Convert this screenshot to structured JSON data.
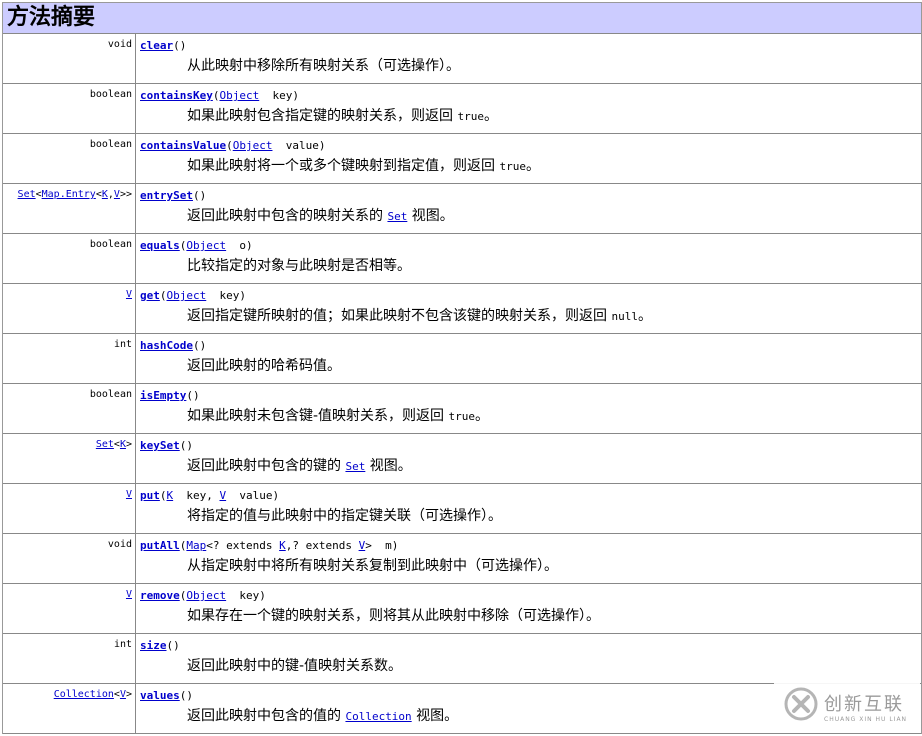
{
  "title": "方法摘要",
  "rows": [
    {
      "rtype": [
        {
          "text": "void"
        }
      ],
      "name": "clear",
      "params": [
        {
          "text": "()"
        }
      ],
      "desc": [
        {
          "text": "从此映射中移除所有映射关系（可选操作）。"
        }
      ]
    },
    {
      "rtype": [
        {
          "text": "boolean"
        }
      ],
      "name": "containsKey",
      "params": [
        {
          "text": "("
        },
        {
          "text": "Object",
          "link": true
        },
        {
          "text": "  key)"
        }
      ],
      "desc": [
        {
          "text": "如果此映射包含指定键的映射关系，则返回 "
        },
        {
          "text": "true",
          "code": true
        },
        {
          "text": "。"
        }
      ]
    },
    {
      "rtype": [
        {
          "text": "boolean"
        }
      ],
      "name": "containsValue",
      "params": [
        {
          "text": "("
        },
        {
          "text": "Object",
          "link": true
        },
        {
          "text": "  value)"
        }
      ],
      "desc": [
        {
          "text": "如果此映射将一个或多个键映射到指定值，则返回 "
        },
        {
          "text": "true",
          "code": true
        },
        {
          "text": "。"
        }
      ]
    },
    {
      "rtype": [
        {
          "text": "Set",
          "link": true
        },
        {
          "text": "<"
        },
        {
          "text": "Map.Entry",
          "link": true
        },
        {
          "text": "<"
        },
        {
          "text": "K",
          "link": true
        },
        {
          "text": ","
        },
        {
          "text": "V",
          "link": true
        },
        {
          "text": ">>"
        }
      ],
      "name": "entrySet",
      "params": [
        {
          "text": "()"
        }
      ],
      "desc": [
        {
          "text": "返回此映射中包含的映射关系的 "
        },
        {
          "text": "Set",
          "code": true,
          "link": true
        },
        {
          "text": " 视图。"
        }
      ]
    },
    {
      "rtype": [
        {
          "text": "boolean"
        }
      ],
      "name": "equals",
      "params": [
        {
          "text": "("
        },
        {
          "text": "Object",
          "link": true
        },
        {
          "text": "  o)"
        }
      ],
      "desc": [
        {
          "text": "比较指定的对象与此映射是否相等。"
        }
      ]
    },
    {
      "rtype": [
        {
          "text": "V",
          "link": true
        }
      ],
      "name": "get",
      "params": [
        {
          "text": "("
        },
        {
          "text": "Object",
          "link": true
        },
        {
          "text": "  key)"
        }
      ],
      "desc": [
        {
          "text": "返回指定键所映射的值；如果此映射不包含该键的映射关系，则返回 "
        },
        {
          "text": "null",
          "code": true
        },
        {
          "text": "。"
        }
      ]
    },
    {
      "rtype": [
        {
          "text": "int"
        }
      ],
      "name": "hashCode",
      "params": [
        {
          "text": "()"
        }
      ],
      "desc": [
        {
          "text": "返回此映射的哈希码值。"
        }
      ]
    },
    {
      "rtype": [
        {
          "text": "boolean"
        }
      ],
      "name": "isEmpty",
      "params": [
        {
          "text": "()"
        }
      ],
      "desc": [
        {
          "text": "如果此映射未包含键-值映射关系，则返回 "
        },
        {
          "text": "true",
          "code": true
        },
        {
          "text": "。"
        }
      ]
    },
    {
      "rtype": [
        {
          "text": "Set",
          "link": true
        },
        {
          "text": "<"
        },
        {
          "text": "K",
          "link": true
        },
        {
          "text": ">"
        }
      ],
      "name": "keySet",
      "params": [
        {
          "text": "()"
        }
      ],
      "desc": [
        {
          "text": "返回此映射中包含的键的 "
        },
        {
          "text": "Set",
          "code": true,
          "link": true
        },
        {
          "text": " 视图。"
        }
      ]
    },
    {
      "rtype": [
        {
          "text": "V",
          "link": true
        }
      ],
      "name": "put",
      "params": [
        {
          "text": "("
        },
        {
          "text": "K",
          "link": true
        },
        {
          "text": "  key, "
        },
        {
          "text": "V",
          "link": true
        },
        {
          "text": "  value)"
        }
      ],
      "desc": [
        {
          "text": "将指定的值与此映射中的指定键关联（可选操作）。"
        }
      ]
    },
    {
      "rtype": [
        {
          "text": "void"
        }
      ],
      "name": "putAll",
      "params": [
        {
          "text": "("
        },
        {
          "text": "Map",
          "link": true
        },
        {
          "text": "<? extends "
        },
        {
          "text": "K",
          "link": true
        },
        {
          "text": ",? extends "
        },
        {
          "text": "V",
          "link": true
        },
        {
          "text": ">  m)"
        }
      ],
      "desc": [
        {
          "text": "从指定映射中将所有映射关系复制到此映射中（可选操作）。"
        }
      ]
    },
    {
      "rtype": [
        {
          "text": "V",
          "link": true
        }
      ],
      "name": "remove",
      "params": [
        {
          "text": "("
        },
        {
          "text": "Object",
          "link": true
        },
        {
          "text": "  key)"
        }
      ],
      "desc": [
        {
          "text": "如果存在一个键的映射关系，则将其从此映射中移除（可选操作）。"
        }
      ]
    },
    {
      "rtype": [
        {
          "text": "int"
        }
      ],
      "name": "size",
      "params": [
        {
          "text": "()"
        }
      ],
      "desc": [
        {
          "text": "返回此映射中的键-值映射关系数。"
        }
      ]
    },
    {
      "rtype": [
        {
          "text": "Collection",
          "link": true
        },
        {
          "text": "<"
        },
        {
          "text": "V",
          "link": true
        },
        {
          "text": ">"
        }
      ],
      "name": "values",
      "params": [
        {
          "text": "()"
        }
      ],
      "desc": [
        {
          "text": "返回此映射中包含的值的 "
        },
        {
          "text": "Collection",
          "code": true,
          "link": true
        },
        {
          "text": " 视图。"
        }
      ]
    }
  ],
  "watermark": {
    "cn": "创新互联",
    "en": "CHUANG XIN HU LIAN",
    "icon": "logo-x-icon"
  }
}
